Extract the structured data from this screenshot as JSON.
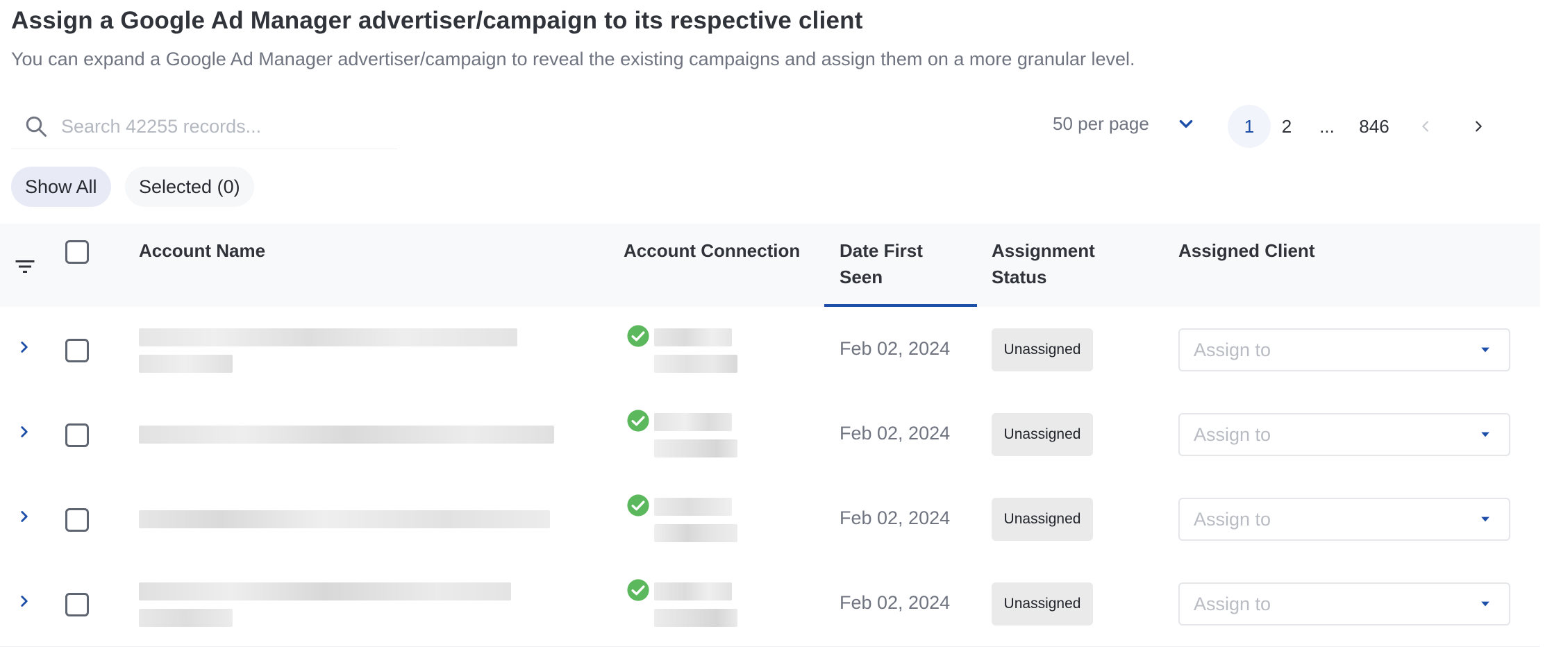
{
  "header": {
    "title": "Assign a Google Ad Manager advertiser/campaign to its respective client",
    "subtitle": "You can expand a Google Ad Manager advertiser/campaign to reveal the existing campaigns and assign them on a more granular level."
  },
  "search": {
    "placeholder": "Search 42255 records..."
  },
  "pagination": {
    "per_page_label": "50 per page",
    "pages": [
      "1",
      "2",
      "...",
      "846"
    ],
    "current": "1"
  },
  "filters": {
    "show_all": "Show All",
    "selected": "Selected (0)"
  },
  "table": {
    "columns": {
      "account_name": "Account Name",
      "account_connection": "Account Connection",
      "date_first_seen_line1": "Date First",
      "date_first_seen_line2": "Seen",
      "assignment_status_line1": "Assignment",
      "assignment_status_line2": "Status",
      "assigned_client": "Assigned Client"
    },
    "rows": [
      {
        "date": "Feb 02, 2024",
        "status": "Unassigned",
        "assign_placeholder": "Assign to"
      },
      {
        "date": "Feb 02, 2024",
        "status": "Unassigned",
        "assign_placeholder": "Assign to"
      },
      {
        "date": "Feb 02, 2024",
        "status": "Unassigned",
        "assign_placeholder": "Assign to"
      },
      {
        "date": "Feb 02, 2024",
        "status": "Unassigned",
        "assign_placeholder": "Assign to"
      }
    ]
  },
  "colors": {
    "accent": "#1d4ea8",
    "connected": "#5cb85c",
    "badge_bg": "#eaeaeb"
  },
  "icons": [
    "search-icon",
    "chevron-down-icon",
    "chevron-left-icon",
    "chevron-right-icon",
    "filter-icon",
    "expand-chevron-icon",
    "check-circle-icon",
    "caret-down-icon"
  ]
}
